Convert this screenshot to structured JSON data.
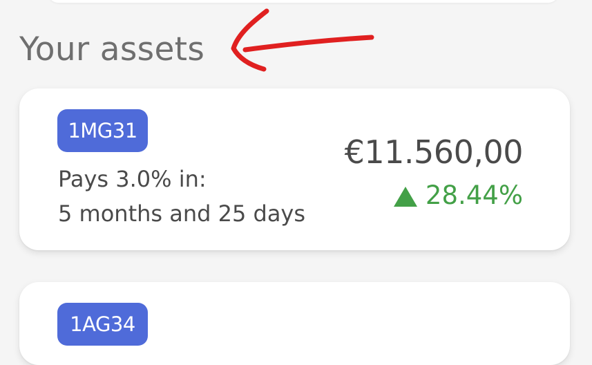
{
  "section": {
    "title": "Your assets"
  },
  "assets": [
    {
      "code": "1MG31",
      "pay_text": "Pays 3.0% in:",
      "time_text": "5 months and 25 days",
      "amount": "€11.560,00",
      "change": "28.44%",
      "trend_icon": "up-triangle-icon"
    },
    {
      "code": "1AG34"
    }
  ],
  "colors": {
    "background": "#f5f5f5",
    "badge": "#4f6bd9",
    "positive": "#43a047",
    "annotation": "#e02020",
    "text": "#4a4a4a",
    "title": "#6f6f6f"
  }
}
